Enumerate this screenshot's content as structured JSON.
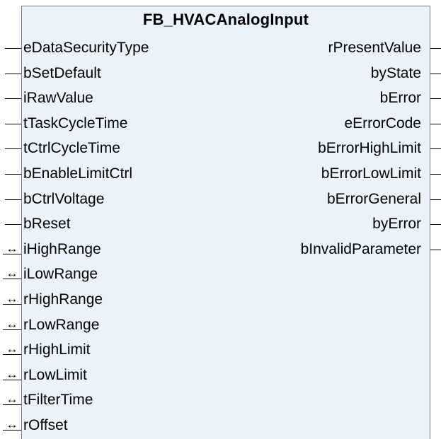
{
  "block": {
    "title": "FB_HVACAnalogInput",
    "inputs": [
      {
        "label": "eDataSecurityType",
        "kind": "input"
      },
      {
        "label": "bSetDefault",
        "kind": "input"
      },
      {
        "label": "iRawValue",
        "kind": "input"
      },
      {
        "label": "tTaskCycleTime",
        "kind": "input"
      },
      {
        "label": "tCtrlCycleTime",
        "kind": "input"
      },
      {
        "label": "bEnableLimitCtrl",
        "kind": "input"
      },
      {
        "label": "bCtrlVoltage",
        "kind": "input"
      },
      {
        "label": "bReset",
        "kind": "input"
      },
      {
        "label": "iHighRange",
        "kind": "in-out"
      },
      {
        "label": "iLowRange",
        "kind": "in-out"
      },
      {
        "label": "rHighRange",
        "kind": "in-out"
      },
      {
        "label": "rLowRange",
        "kind": "in-out"
      },
      {
        "label": "rHighLimit",
        "kind": "in-out"
      },
      {
        "label": "rLowLimit",
        "kind": "in-out"
      },
      {
        "label": "tFilterTime",
        "kind": "in-out"
      },
      {
        "label": "rOffset",
        "kind": "in-out"
      }
    ],
    "outputs": [
      {
        "label": "rPresentValue"
      },
      {
        "label": "byState"
      },
      {
        "label": "bError"
      },
      {
        "label": "eErrorCode"
      },
      {
        "label": "bErrorHighLimit"
      },
      {
        "label": "bErrorLowLimit"
      },
      {
        "label": "bErrorGeneral"
      },
      {
        "label": "byError"
      },
      {
        "label": "bInvalidParameter"
      }
    ],
    "inout_symbol": "↔",
    "colors": {
      "box_fill": "#ebf2f9",
      "box_border": "#6e7e8e",
      "text": "#000000"
    }
  }
}
